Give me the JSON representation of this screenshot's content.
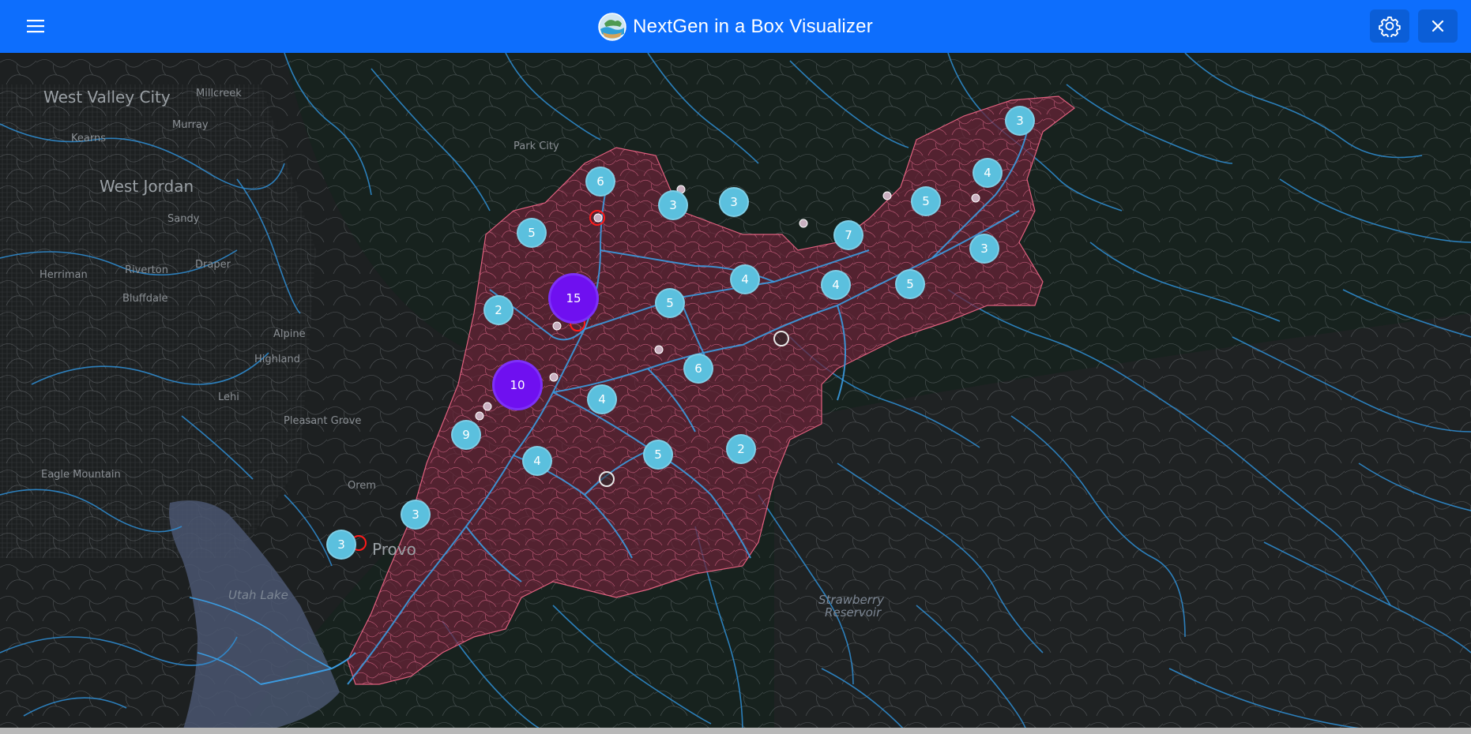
{
  "header": {
    "title": "NextGen in a Box Visualizer",
    "background": "#0d6efd"
  },
  "icons": {
    "menu": "hamburger-menu-icon",
    "logo": "nextgen-globe-logo",
    "settings": "gear-icon",
    "close": "close-icon"
  },
  "map": {
    "basemap": "dark",
    "place_labels": [
      "West Valley City",
      "Millcreek",
      "Murray",
      "Kearns",
      "West Jordan",
      "Sandy",
      "Park City",
      "Riverton",
      "Draper",
      "Herriman",
      "Bluffdale",
      "Alpine",
      "Highland",
      "Lehi",
      "Pleasant Grove",
      "Orem",
      "Eagle Mountain",
      "Provo",
      "Utah Lake",
      "Strawberry",
      "Reservoir"
    ],
    "colors": {
      "catchment_fill": "#6b2238",
      "catchment_border": "#e0607e",
      "rivers": "#2f8fd6",
      "cluster_small": "#5bc0de",
      "cluster_large": "#6f10f0",
      "gauge_marker": "#ff1a1a",
      "lake": "#4a5670"
    },
    "clusters": [
      {
        "count": "3"
      },
      {
        "count": "4"
      },
      {
        "count": "6"
      },
      {
        "count": "3"
      },
      {
        "count": "3"
      },
      {
        "count": "5"
      },
      {
        "count": "5"
      },
      {
        "count": "7"
      },
      {
        "count": "3"
      },
      {
        "count": "15"
      },
      {
        "count": "2"
      },
      {
        "count": "5"
      },
      {
        "count": "4"
      },
      {
        "count": "4"
      },
      {
        "count": "5"
      },
      {
        "count": "10"
      },
      {
        "count": "6"
      },
      {
        "count": "4"
      },
      {
        "count": "9"
      },
      {
        "count": "4"
      },
      {
        "count": "5"
      },
      {
        "count": "2"
      },
      {
        "count": "3"
      },
      {
        "count": "3"
      }
    ]
  }
}
